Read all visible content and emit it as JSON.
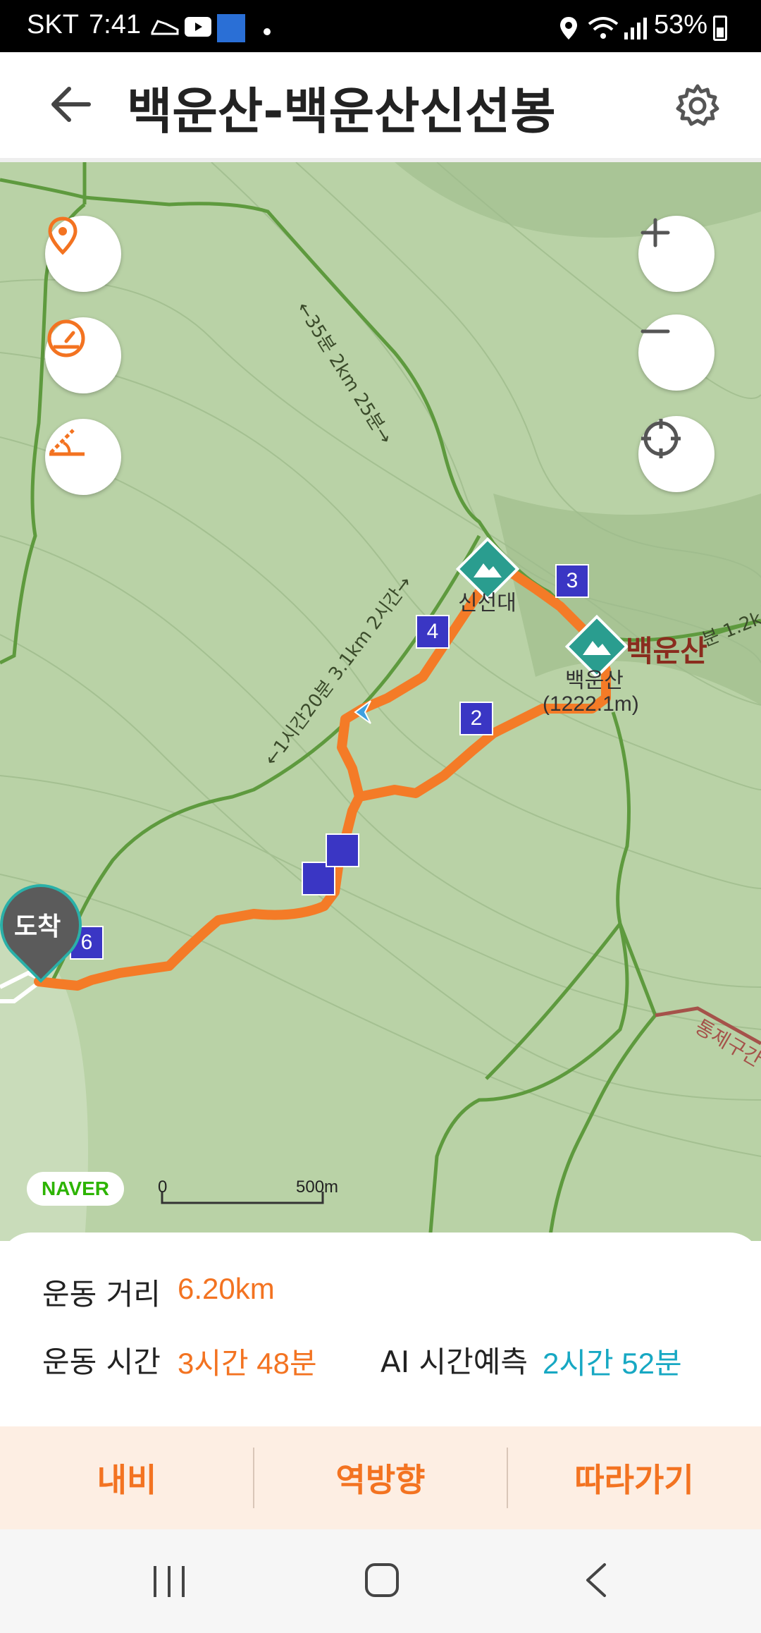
{
  "status_bar": {
    "carrier": "SKT",
    "time": "7:41",
    "battery": "53%"
  },
  "header": {
    "title": "백운산-백운산신선봉",
    "back_icon": "arrow-left-icon",
    "settings_icon": "gear-icon"
  },
  "map": {
    "peak_main_name": "백운산",
    "peak_main_label": "백운산",
    "peak_main_elevation": "(1222.1m)",
    "peak_sub_label": "신선대",
    "trail_top": "←35분 2km 25분→",
    "trail_left": "←1시간20분 3.1km 2시간→",
    "trail_right": "분 1.2k",
    "trail_bottom": "통제구간",
    "arrive_label": "도착",
    "waypoints": [
      "2",
      "3",
      "4",
      "6"
    ],
    "brand": "NAVER",
    "scale_start": "0",
    "scale_end": "500m",
    "route_color": "#f47b27"
  },
  "stats": {
    "distance_label": "운동 거리",
    "distance_value": "6.20km",
    "time_label": "운동 시간",
    "time_value": "3시간 48분",
    "ai_label": "AI 시간예측",
    "ai_value": "2시간 52분"
  },
  "actions": {
    "navi": "내비",
    "reverse": "역방향",
    "follow": "따라가기"
  }
}
